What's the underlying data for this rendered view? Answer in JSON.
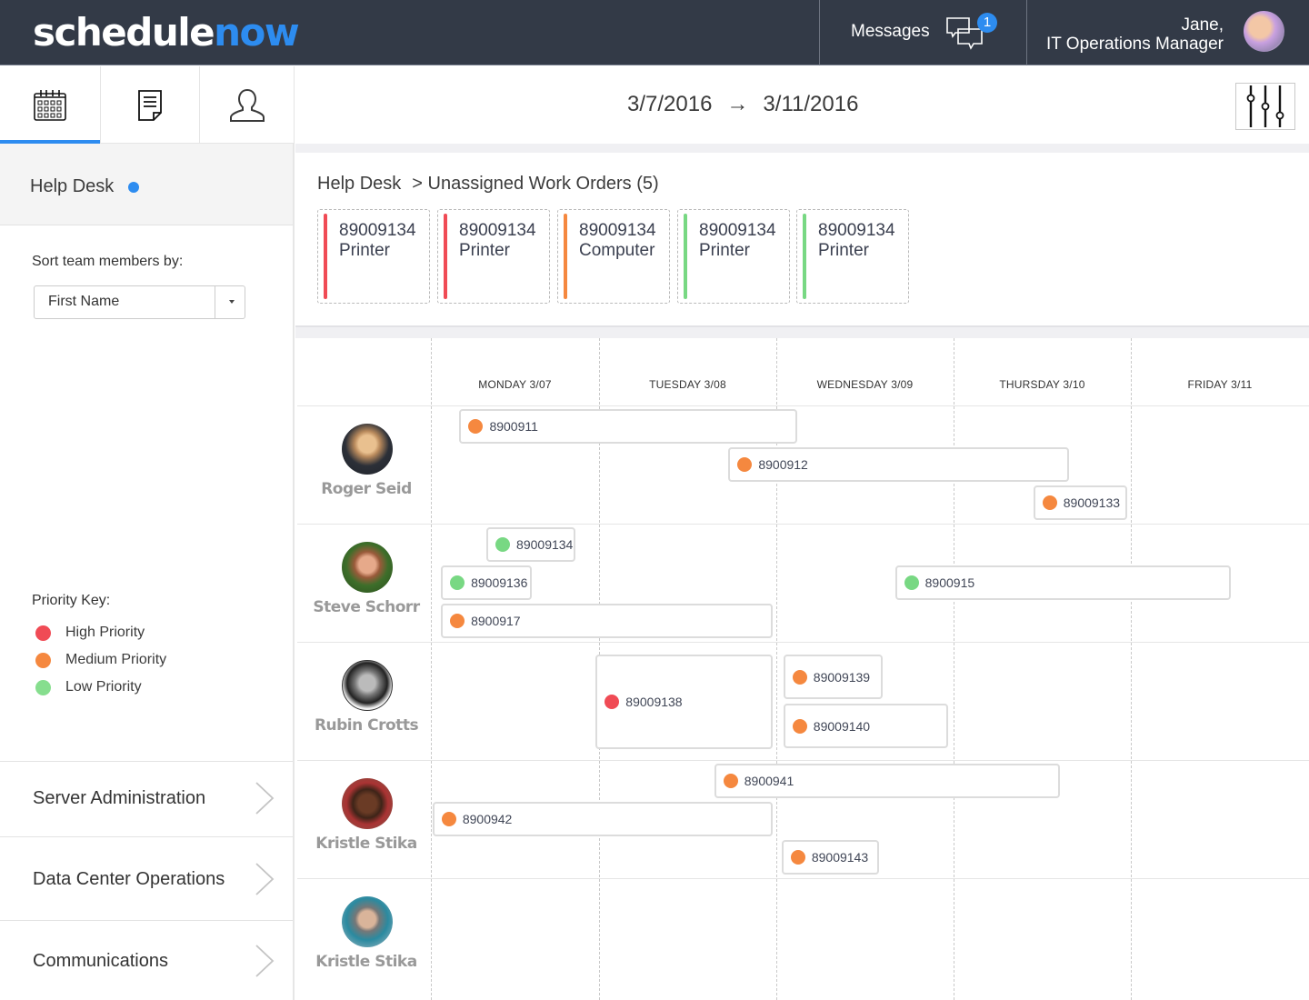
{
  "header": {
    "logo_part1": "schedule",
    "logo_part2": "now",
    "messages_label": "Messages",
    "messages_count": "1",
    "user_name_line1": "Jane,",
    "user_name_line2": "IT Operations Manager"
  },
  "nav_tabs": [
    {
      "name": "calendar",
      "icon": "calendar-icon",
      "active": true
    },
    {
      "name": "documents",
      "icon": "document-icon",
      "active": false
    },
    {
      "name": "people",
      "icon": "user-icon",
      "active": false
    }
  ],
  "date_range": {
    "start": "3/7/2016",
    "arrow": "→",
    "end": "3/11/2016"
  },
  "sidebar": {
    "team_name": "Help Desk",
    "sort_label": "Sort team members by:",
    "sort_value": "First Name",
    "priority_key_title": "Priority Key:",
    "priority_key": [
      {
        "label": "High Priority",
        "color": "#f04b55"
      },
      {
        "label": "Medium Priority",
        "color": "#f5883f"
      },
      {
        "label": "Low Priority",
        "color": "#86de8e"
      }
    ],
    "groups": [
      {
        "label": "Server Administration"
      },
      {
        "label": "Data Center Operations"
      },
      {
        "label": "Communications"
      }
    ]
  },
  "breadcrumb": {
    "root": "Help Desk",
    "current": "> Unassigned Work Orders (5)"
  },
  "unassigned": [
    {
      "id": "89009134",
      "type": "Printer",
      "priority": "high"
    },
    {
      "id": "89009134",
      "type": "Printer",
      "priority": "high"
    },
    {
      "id": "89009134",
      "type": "Computer",
      "priority": "medium"
    },
    {
      "id": "89009134",
      "type": "Printer",
      "priority": "low"
    },
    {
      "id": "89009134",
      "type": "Printer",
      "priority": "low"
    }
  ],
  "colors": {
    "high": "#f04b55",
    "medium": "#f5883f",
    "low": "#78d883",
    "accent": "#2d8cf0",
    "topbar": "#333a47"
  },
  "days": [
    "MONDAY 3/07",
    "TUESDAY 3/08",
    "WEDNESDAY 3/09",
    "THURSDAY 3/10",
    "FRIDAY 3/11"
  ],
  "team": [
    {
      "name": "Roger Seid",
      "tasks": [
        {
          "id": "8900911",
          "priority": "medium",
          "start": 0.17,
          "end": 2.12,
          "lane": 0
        },
        {
          "id": "8900912",
          "priority": "medium",
          "start": 1.73,
          "end": 3.65,
          "lane": 1
        },
        {
          "id": "89009133",
          "priority": "medium",
          "start": 3.45,
          "end": 3.98,
          "lane": 2
        }
      ]
    },
    {
      "name": "Steve Schorr",
      "tasks": [
        {
          "id": "89009134",
          "priority": "low",
          "start": 0.33,
          "end": 0.86,
          "lane": 0
        },
        {
          "id": "89009136",
          "priority": "low",
          "start": 0.06,
          "end": 0.6,
          "lane": 1
        },
        {
          "id": "8900917",
          "priority": "medium",
          "start": 0.06,
          "end": 1.98,
          "lane": 2
        },
        {
          "id": "8900915",
          "priority": "low",
          "start": 2.67,
          "end": 4.56,
          "lane": 1
        }
      ]
    },
    {
      "name": "Rubin Crotts",
      "tasks": [
        {
          "id": "89009138",
          "priority": "high",
          "start": 0.98,
          "end": 1.98,
          "lane": "full"
        },
        {
          "id": "89009139",
          "priority": "medium",
          "start": 2.04,
          "end": 2.6,
          "lane": "top"
        },
        {
          "id": "89009140",
          "priority": "medium",
          "start": 2.04,
          "end": 2.97,
          "lane": "bottom"
        }
      ]
    },
    {
      "name": "Kristle Stika",
      "tasks": [
        {
          "id": "8900941",
          "priority": "medium",
          "start": 1.65,
          "end": 3.6,
          "lane": 0
        },
        {
          "id": "8900942",
          "priority": "medium",
          "start": 0.01,
          "end": 1.98,
          "lane": 1
        },
        {
          "id": "89009143",
          "priority": "medium",
          "start": 2.03,
          "end": 2.58,
          "lane": 2
        }
      ]
    },
    {
      "name": "Kristle Stika",
      "tasks": []
    }
  ]
}
